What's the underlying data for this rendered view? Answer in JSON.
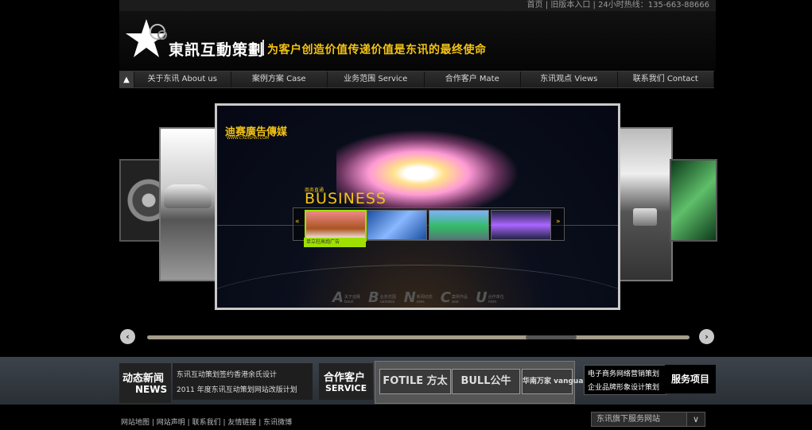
{
  "top": {
    "links": [
      "首页",
      "旧版本入口",
      "24小时热线：135-663-88666"
    ]
  },
  "header": {
    "logo_text": "東訊互動策劃",
    "slogan": "为客户创造价值传递价值是东讯的最终使命"
  },
  "nav": {
    "home_icon": "home-arrow-icon",
    "items": [
      "关于东讯 About us",
      "案例方案  Case",
      "业务范围 Service",
      "合作客户 Mate",
      "东讯观点 Views",
      "联系我们 Contact"
    ]
  },
  "carousel": {
    "brand": "迪赛廣告傳媒",
    "brand_url": "WWW.CXDISHAI.COM",
    "sub_label": "商务直通",
    "big_label": "BUSINESS",
    "caption": "单立柱高炮广告",
    "menu": [
      {
        "letter": "A",
        "cn": "关于迪赛",
        "en": "bout"
      },
      {
        "letter": "B",
        "cn": "业务范围",
        "en": "usiness"
      },
      {
        "letter": "N",
        "cn": "新闻动态",
        "en": "ews"
      },
      {
        "letter": "C",
        "cn": "案例作品",
        "en": "ase"
      },
      {
        "letter": "U",
        "cn": "合作单位",
        "en": "nion"
      }
    ]
  },
  "scroll": {
    "left": "‹",
    "right": "›",
    "position_fraction": 0.77
  },
  "news": {
    "title_cn": "动态新闻",
    "title_en": "NEWS",
    "items": [
      "东讯互动策划签约香港余氏设计",
      "2011 年度东讯互动策划网站改版计划"
    ]
  },
  "service": {
    "title_cn": "合作客户",
    "title_en": "SERVICE",
    "partners": [
      "FOTILE 方太",
      "BULL公牛",
      "华南万家 vanguard"
    ]
  },
  "business": {
    "items": [
      "电子商务网络营销策划",
      "企业品牌形象设计策划"
    ],
    "title": "服务项目"
  },
  "footer": {
    "links": [
      "网站地图",
      "网站声明",
      "联系我们",
      "友情链接",
      "东讯微博"
    ],
    "select_label": "东讯旗下服务网站",
    "select_icon": "chevron-down-icon"
  }
}
